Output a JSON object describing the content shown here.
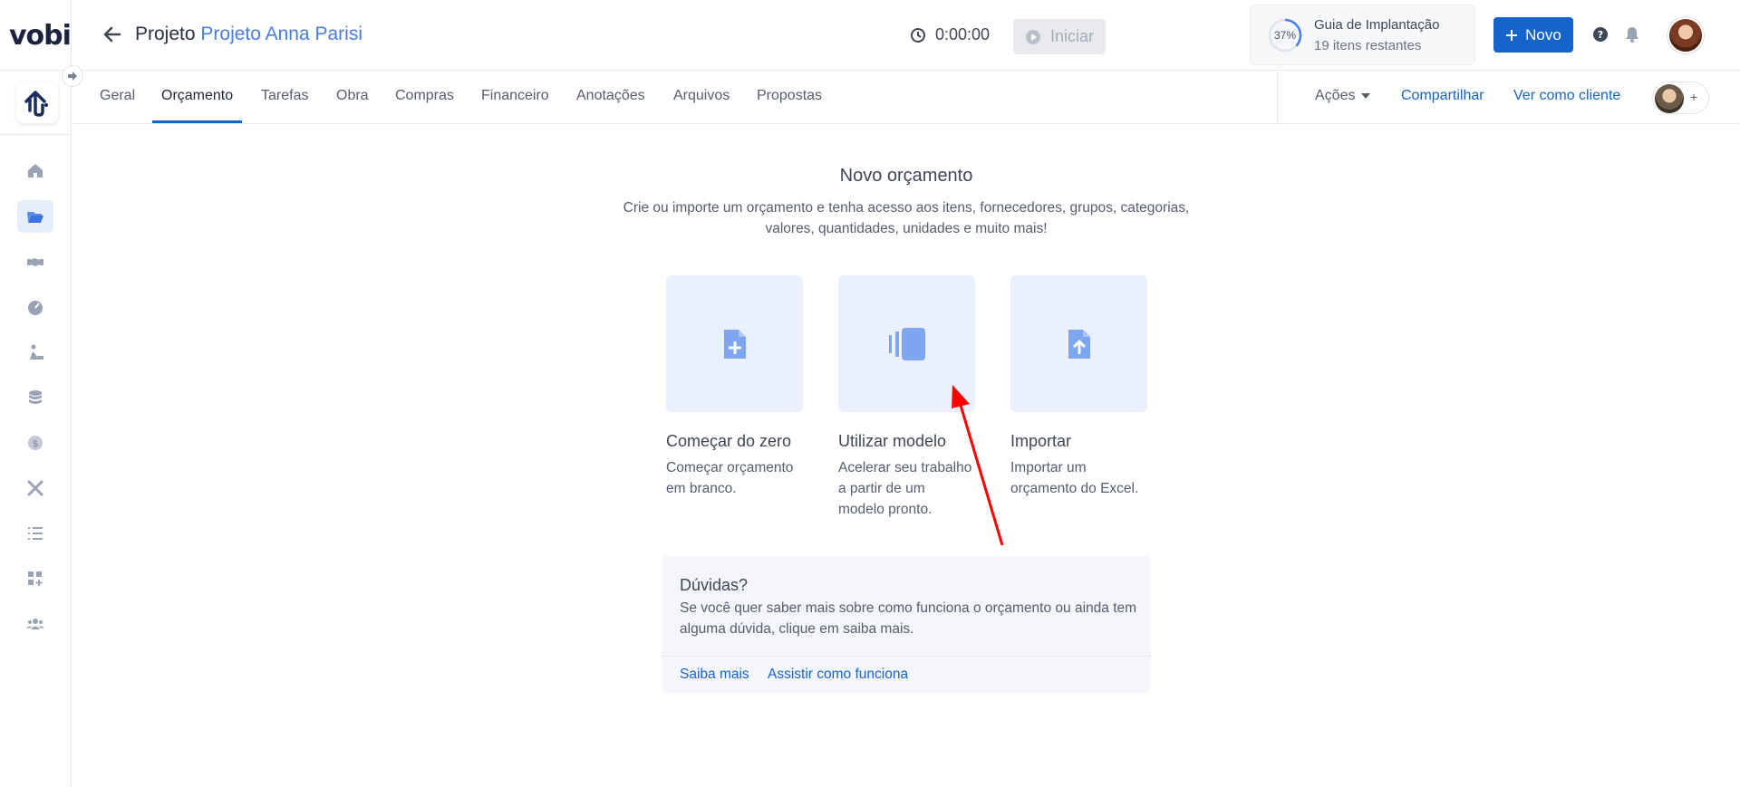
{
  "app": {
    "logo_text": "vobi"
  },
  "rail": {
    "items": [
      {
        "name": "home-icon",
        "active": false
      },
      {
        "name": "folder-icon",
        "active": true
      },
      {
        "name": "handshake-icon",
        "active": false
      },
      {
        "name": "gauge-icon",
        "active": false
      },
      {
        "name": "worker-icon",
        "active": false
      },
      {
        "name": "database-icon",
        "active": false
      },
      {
        "name": "dollar-icon",
        "active": false
      },
      {
        "name": "tools-icon",
        "active": false
      },
      {
        "name": "list-icon",
        "active": false
      },
      {
        "name": "apps-add-icon",
        "active": false
      },
      {
        "name": "users-icon",
        "active": false
      }
    ]
  },
  "header": {
    "project_prefix": "Projeto",
    "project_name": "Projeto Anna Parisi",
    "timer": "0:00:00",
    "start_label": "Iniciar",
    "guide": {
      "percent": "37%",
      "progress": 0.37,
      "title": "Guia de Implantação",
      "subtitle": "19 itens restantes"
    },
    "new_label": "Novo"
  },
  "tabs": {
    "items": [
      "Geral",
      "Orçamento",
      "Tarefas",
      "Obra",
      "Compras",
      "Financeiro",
      "Anotações",
      "Arquivos",
      "Propostas"
    ],
    "active": "Orçamento",
    "actions_label": "Ações",
    "share_label": "Compartilhar",
    "view_as_client_label": "Ver como cliente",
    "share_plus": "+"
  },
  "main": {
    "title": "Novo orçamento",
    "description": "Crie ou importe um orçamento e tenha acesso aos itens, fornecedores, grupos, categorias, valores, quantidades, unidades e muito mais!",
    "cards": [
      {
        "title": "Começar do zero",
        "desc": "Começar orçamento em branco.",
        "icon": "file-plus-icon"
      },
      {
        "title": "Utilizar modelo",
        "desc": "Acelerar seu trabalho a partir de um modelo pronto.",
        "icon": "template-icon"
      },
      {
        "title": "Importar",
        "desc": "Importar um orçamento do Excel.",
        "icon": "file-upload-icon"
      }
    ]
  },
  "help": {
    "title": "Dúvidas?",
    "text": "Se você quer saber mais sobre como funciona o orçamento ou ainda tem alguma dúvida, clique em saiba mais.",
    "link_more": "Saiba mais",
    "link_watch": "Assistir como funciona"
  },
  "colors": {
    "accent": "#1464cc",
    "link": "#4a7de0",
    "card_bg": "#eaf0fd",
    "icon": "#7ea6f0",
    "annotation": "#ff0000"
  }
}
